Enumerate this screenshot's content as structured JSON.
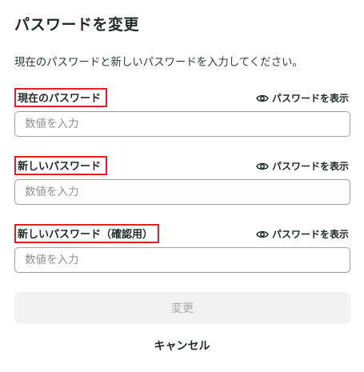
{
  "title": "パスワードを変更",
  "description": "現在のパスワードと新しいパスワードを入力してください。",
  "fields": [
    {
      "label": "現在のパスワード",
      "toggle_label": "パスワードを表示",
      "toggle_icon": "eye-icon",
      "placeholder": "数値を入力",
      "value": ""
    },
    {
      "label": "新しいパスワード",
      "toggle_label": "パスワードを表示",
      "toggle_icon": "eye-icon",
      "placeholder": "数値を入力",
      "value": ""
    },
    {
      "label": "新しいパスワード（確認用）",
      "toggle_label": "パスワードを表示",
      "toggle_icon": "eye-icon",
      "placeholder": "数値を入力",
      "value": ""
    }
  ],
  "submit_label": "変更",
  "cancel_label": "キャンセル",
  "colors": {
    "text": "#1f2a24",
    "highlight_border": "#e02020",
    "input_border": "#9aa39e",
    "disabled_button_bg": "#f1f3f2",
    "disabled_button_text": "#a5aaa7"
  }
}
